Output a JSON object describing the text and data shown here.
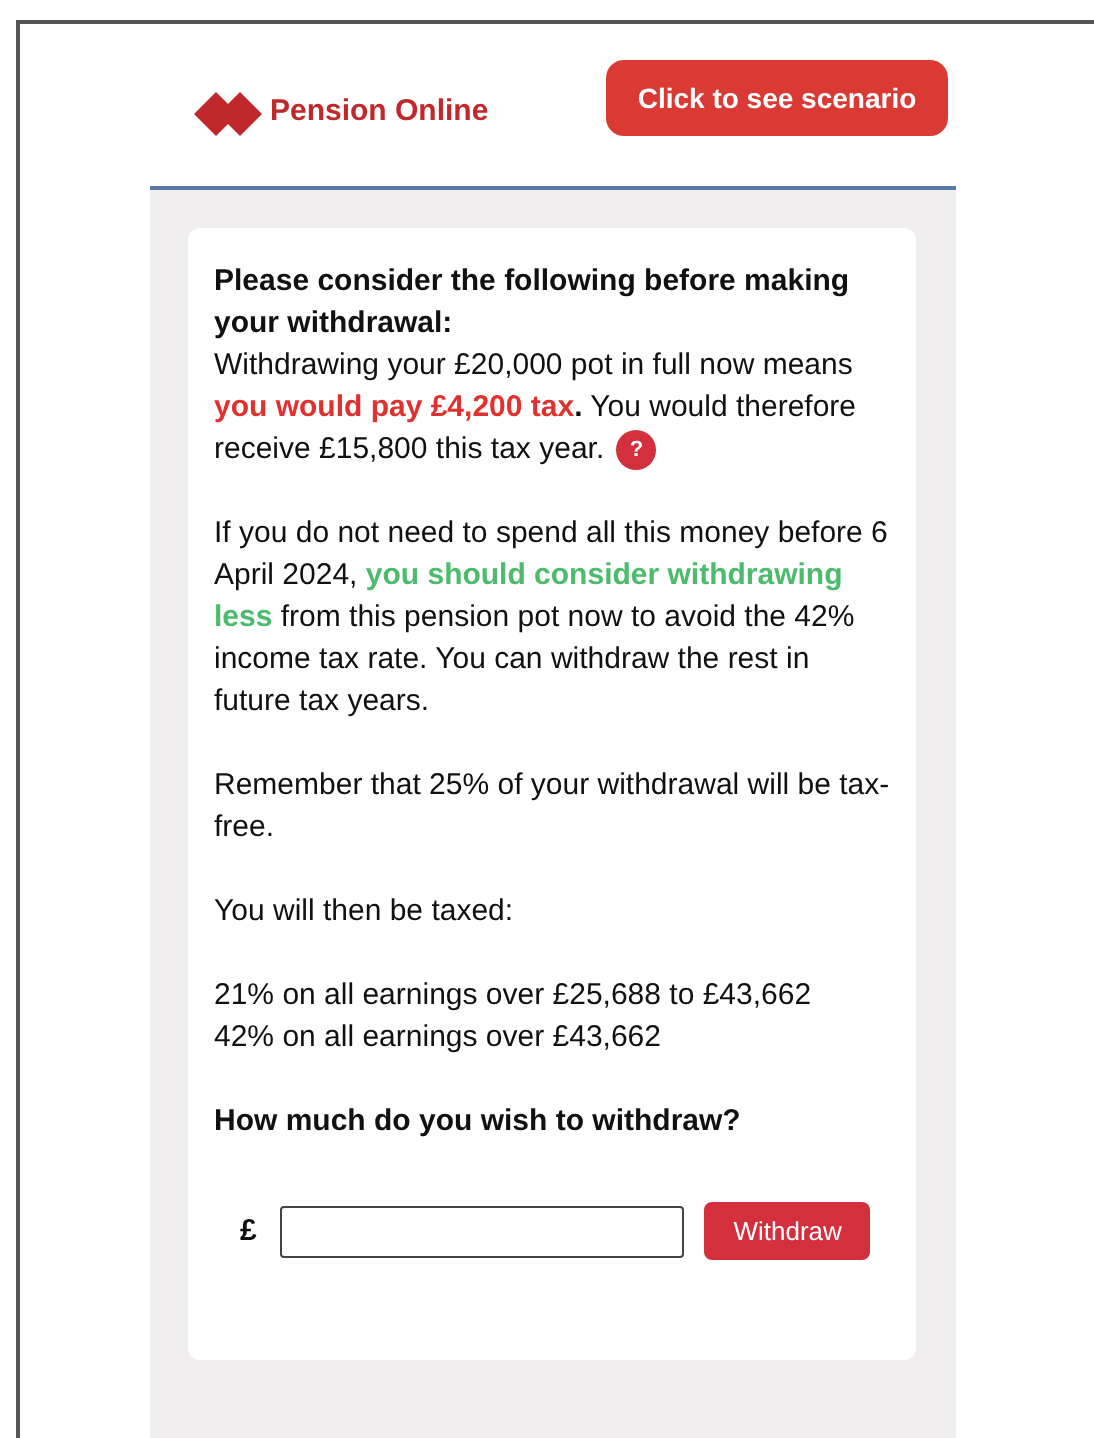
{
  "header": {
    "brand": "Pension Online",
    "scenario_button": "Click to see scenario"
  },
  "notice": {
    "heading": "Please consider the following before making your withdrawal:",
    "paragraphs": [
      {
        "segments": [
          {
            "kind": "plain",
            "text": "Withdrawing your £20,000 pot in full now means "
          },
          {
            "kind": "warning",
            "text": "you would pay £4,200 tax"
          },
          {
            "kind": "plain",
            "text": "**.** You would therefore receive £15,800 this tax year. "
          }
        ],
        "help_button": "?"
      },
      {
        "segments": [
          {
            "kind": "plain",
            "text": "If you do not need to spend all this money before 6 April 2024, "
          },
          {
            "kind": "advice",
            "text": "you should consider withdrawing less"
          },
          {
            "kind": "plain",
            "text": " from this pension pot now to avoid the 42% income tax rate. You can withdraw the rest in future tax years."
          }
        ]
      },
      {
        "segments": [
          {
            "kind": "plain",
            "text": "Remember that 25% of your withdrawal will be tax-free."
          }
        ]
      },
      {
        "segments": [
          {
            "kind": "plain",
            "text": "You will then be taxed:"
          }
        ]
      }
    ],
    "tax_bands": [
      "21% on all earnings over £25,688 to £43,662",
      "42% on all earnings over £43,662"
    ],
    "question": "How much do you wish to withdraw?"
  },
  "withdraw_form": {
    "currency": "£",
    "button": "Withdraw"
  }
}
